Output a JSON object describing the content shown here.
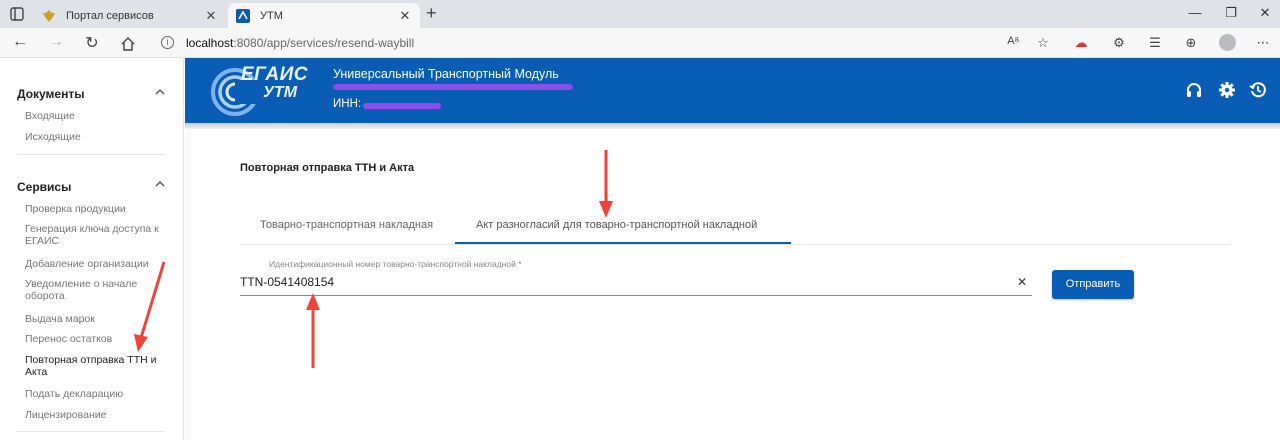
{
  "browser": {
    "tabs": [
      {
        "title": "Портал сервисов",
        "active": false
      },
      {
        "title": "УТМ",
        "active": true
      }
    ],
    "url_host": "localhost",
    "url_path": ":8080/app/services/resend-waybill"
  },
  "sidebar": {
    "sections": [
      {
        "heading": "Документы",
        "items": [
          "Входящие",
          "Исходящие"
        ]
      },
      {
        "heading": "Сервисы",
        "items": [
          "Проверка продукции",
          "Генерация ключа доступа к ЕГАИС",
          "Добавление организации",
          "Уведомление о начале оборота",
          "Выдача марок",
          "Перенос остатков",
          "Повторная отправка ТТН и Акта",
          "Подать декларацию",
          "Лицензирование"
        ],
        "active_item": "Повторная отправка ТТН и Акта"
      }
    ]
  },
  "header": {
    "logo_egais": "ЕГАИС",
    "logo_utm": "УТМ",
    "title": "Универсальный Транспортный Модуль",
    "inn_label": "ИНН:",
    "icons": [
      "headset-icon",
      "gear-icon",
      "history-icon"
    ]
  },
  "main": {
    "page_title": "Повторная отправка ТТН и Акта",
    "tabs": [
      {
        "label": "Товарно-транспортная накладная",
        "selected": false
      },
      {
        "label": "Акт разногласий для товарно-транспортной накладной",
        "selected": true
      }
    ],
    "field": {
      "label": "Идентификационный номер товарно-транспортной накладной *",
      "value": "TTN-0541408154"
    },
    "submit_label": "Отправить"
  },
  "colors": {
    "brand": "#0a5db5",
    "annotation_arrow": "#f0433a",
    "redaction": "#9a4df0"
  }
}
